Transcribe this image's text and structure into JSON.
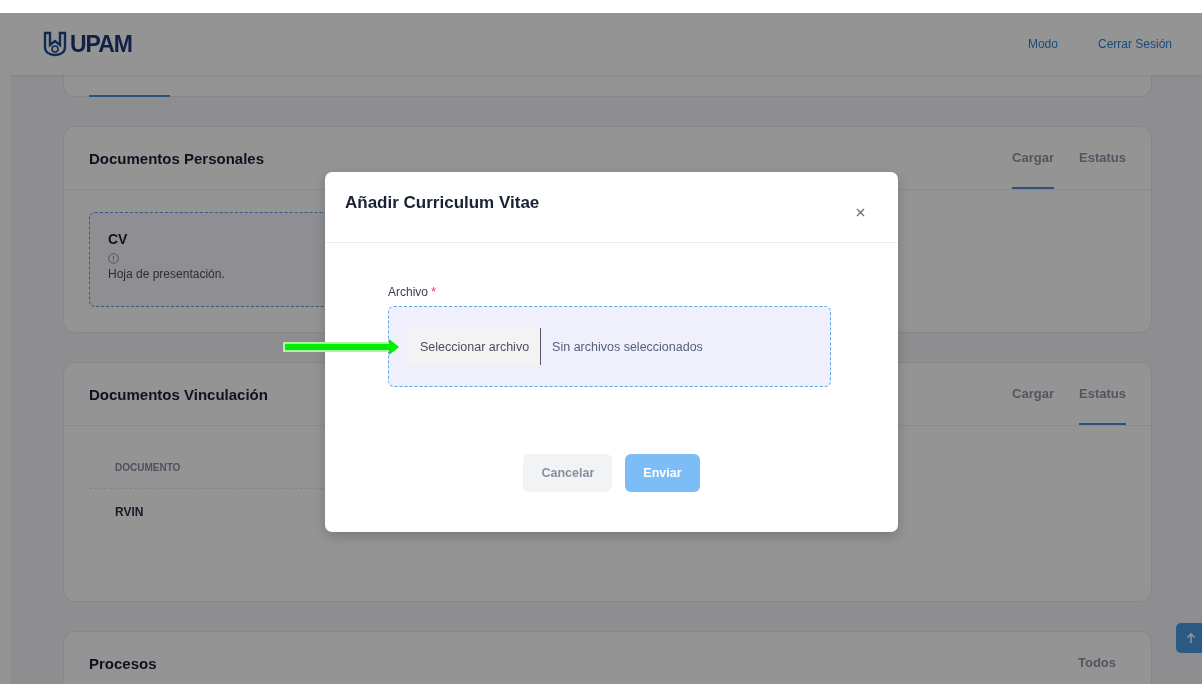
{
  "header": {
    "logo": "UPAM",
    "nav": [
      "Modo",
      "Cerrar Sesión"
    ]
  },
  "sections": [
    {
      "kind": "documents",
      "title": "Documentos Personales",
      "tabs": [
        {
          "label": "Cargar",
          "selected": true
        },
        {
          "label": "Estatus",
          "selected": false
        }
      ],
      "documents": [
        {
          "name": "CV",
          "description": "Hoja de presentación."
        }
      ]
    },
    {
      "kind": "table",
      "title": "Documentos Vinculación",
      "tabs": [
        {
          "label": "Cargar",
          "selected": false
        },
        {
          "label": "Estatus",
          "selected": true
        }
      ],
      "columns": [
        "DOCUMENTO"
      ],
      "rows": [
        [
          "RVIN"
        ]
      ]
    },
    {
      "kind": "plain",
      "title": "Procesos",
      "tabs": [
        {
          "label": "Todos"
        }
      ]
    }
  ],
  "modal": {
    "title": "Añadir Curriculum Vitae",
    "field": {
      "label": "Archivo",
      "required_mark": "*",
      "button": "Seleccionar archivo",
      "value": "Sin archivos seleccionados"
    },
    "buttons": [
      {
        "label": "Cancelar",
        "kind": "secondary",
        "disabled": false
      },
      {
        "label": "Enviar",
        "kind": "primary",
        "disabled": true
      }
    ]
  }
}
